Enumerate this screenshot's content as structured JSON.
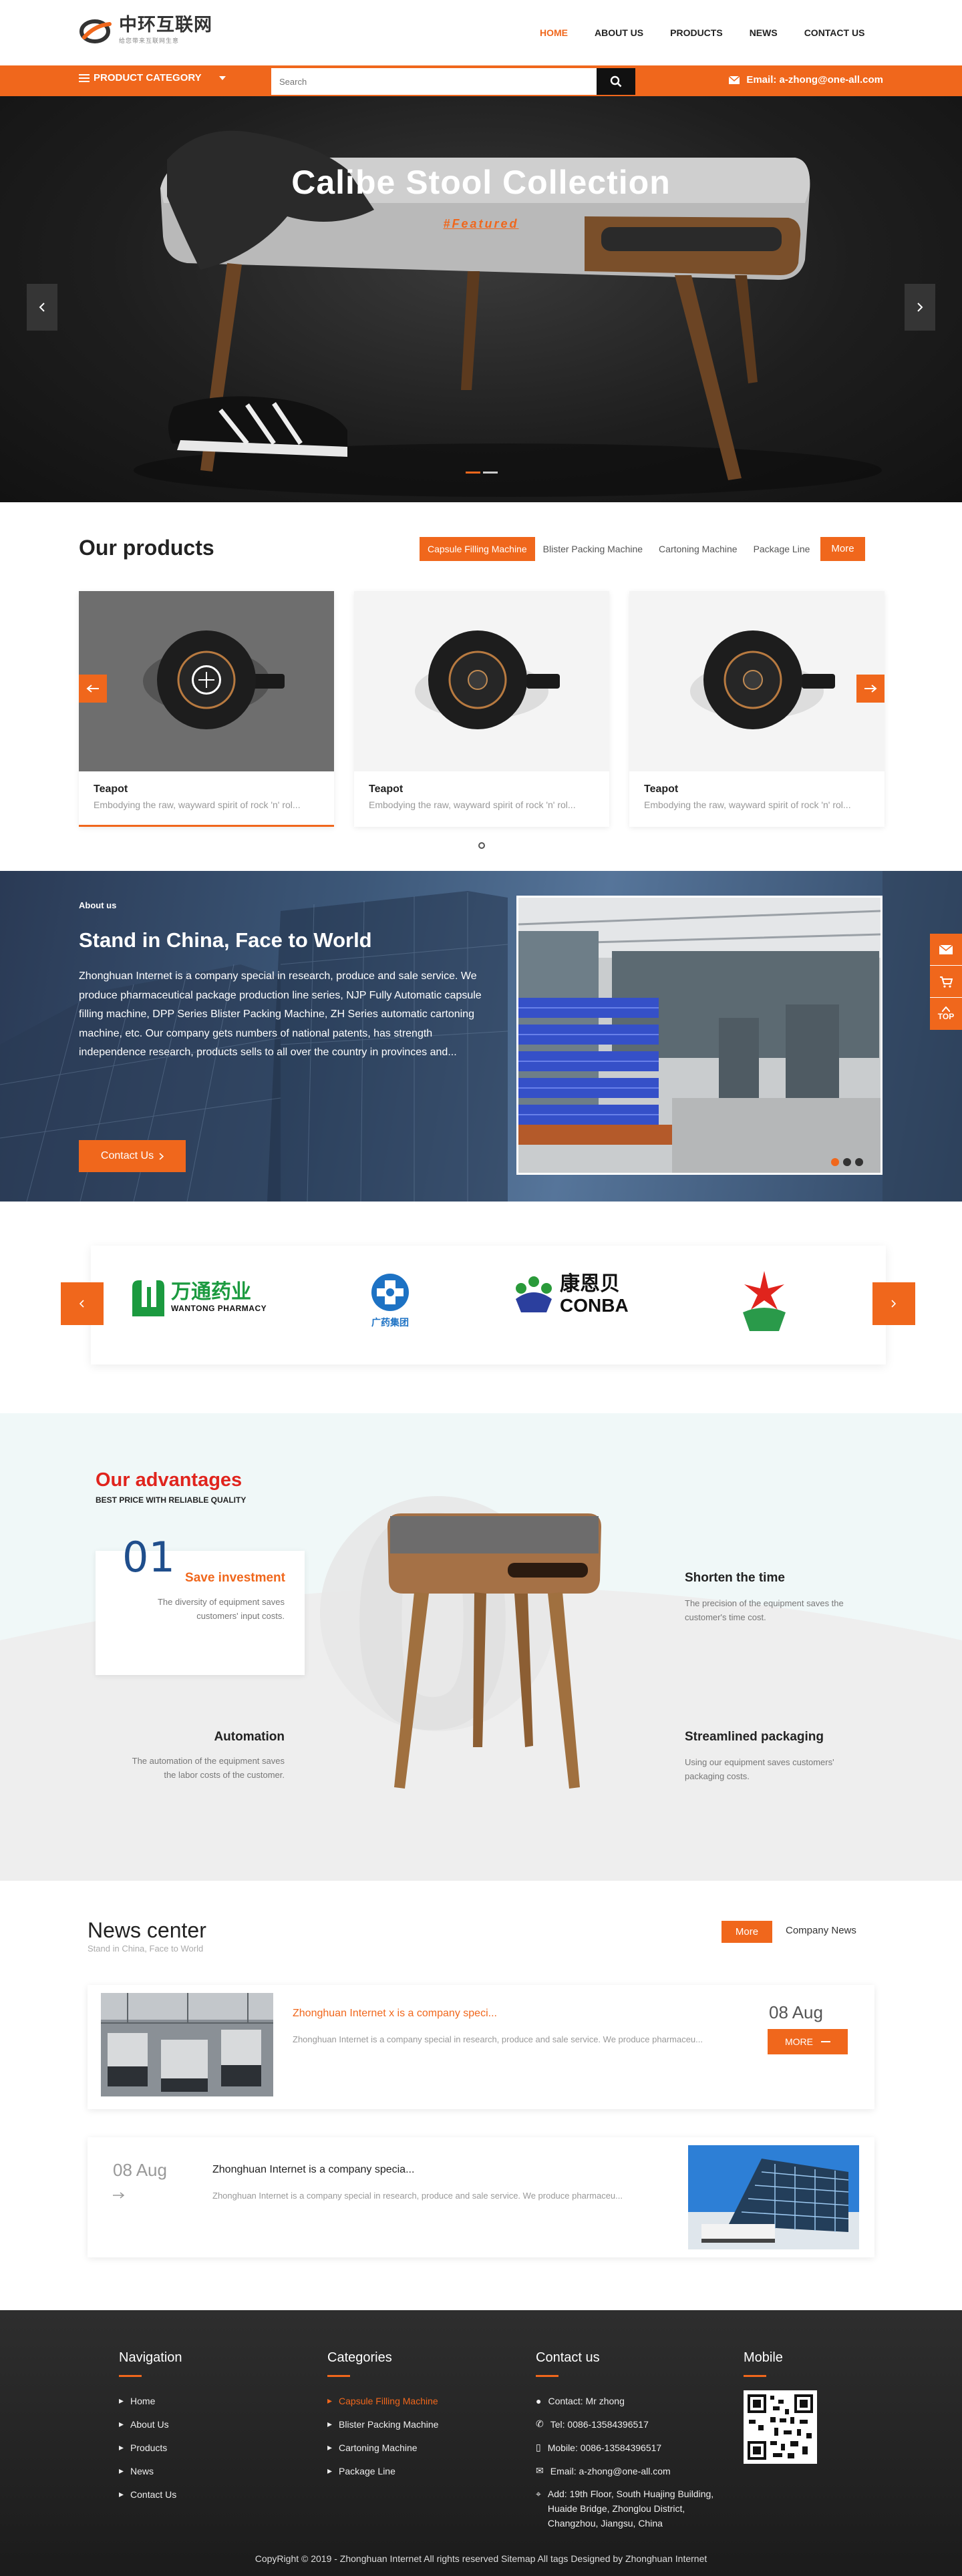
{
  "header": {
    "logo_text": "中环互联网",
    "logo_sub": "给您带来互联网生意",
    "nav": [
      {
        "label": "HOME",
        "active": true
      },
      {
        "label": "ABOUT US",
        "active": false
      },
      {
        "label": "PRODUCTS",
        "active": false
      },
      {
        "label": "NEWS",
        "active": false
      },
      {
        "label": "CONTACT US",
        "active": false
      }
    ]
  },
  "bar": {
    "category_label": "PRODUCT CATEGORY",
    "search_placeholder": "Search",
    "email": "Email: a-zhong@one-all.com"
  },
  "hero": {
    "title": "Calibe Stool Collection",
    "subtitle": "#Featured"
  },
  "products": {
    "title": "Our products",
    "tabs": [
      "Capsule Filling Machine",
      "Blister Packing Machine",
      "Cartoning Machine",
      "Package Line"
    ],
    "more_label": "More",
    "cards": [
      {
        "name": "Teapot",
        "desc": "Embodying the raw, wayward spirit of rock 'n' rol..."
      },
      {
        "name": "Teapot",
        "desc": "Embodying the raw, wayward spirit of rock 'n' rol..."
      },
      {
        "name": "Teapot",
        "desc": "Embodying the raw, wayward spirit of rock 'n' rol..."
      }
    ]
  },
  "about": {
    "label": "About us",
    "title": "Stand in China, Face to World",
    "body": "Zhonghuan Internet is a company special in research, produce and sale service. We produce pharmaceutical package production line series, NJP Fully Automatic capsule filling machine, DPP Series Blister Packing Machine, ZH Series automatic cartoning machine, etc. Our company gets numbers of national patents, has strength independence research, products sells to all over the country in provinces and...",
    "button": "Contact Us"
  },
  "partners": [
    {
      "cn": "万通药业",
      "en": "WANTONG PHARMACY"
    },
    {
      "cn": "广药集团",
      "en": ""
    },
    {
      "cn": "康恩贝",
      "en": "CONBA"
    },
    {
      "cn": "",
      "en": ""
    }
  ],
  "advantages": {
    "title": "Our advantages",
    "subtitle": "BEST PRICE WITH RELIABLE QUALITY",
    "number": "01",
    "items": [
      {
        "title": "Save investment",
        "text": "The diversity of equipment saves customers' input costs."
      },
      {
        "title": "Shorten the time",
        "text": "The precision of the equipment saves the customer's time cost."
      },
      {
        "title": "Automation",
        "text": "The automation of the equipment saves the labor costs of the customer."
      },
      {
        "title": "Streamlined packaging",
        "text": "Using our equipment saves customers' packaging costs."
      }
    ]
  },
  "news": {
    "title": "News center",
    "subtitle": "Stand in China, Face to World",
    "more_label": "More",
    "company_label": "Company News",
    "items": [
      {
        "title": "Zhonghuan Internet x is a company speci...",
        "text": "Zhonghuan Internet is a company special in research, produce and sale service. We produce pharmaceu...",
        "date": "08 Aug",
        "button": "MORE"
      },
      {
        "title": "Zhonghuan Internet is a company specia...",
        "text": "Zhonghuan Internet is a company special in research, produce and sale service. We produce pharmaceu...",
        "date": "08 Aug"
      }
    ]
  },
  "footer": {
    "navigation": {
      "title": "Navigation",
      "links": [
        "Home",
        "About Us",
        "Products",
        "News",
        "Contact Us"
      ]
    },
    "categories": {
      "title": "Categories",
      "links": [
        "Capsule Filling Machine",
        "Blister Packing Machine",
        "Cartoning Machine",
        "Package Line"
      ]
    },
    "contact": {
      "title": "Contact us",
      "items": [
        "Contact: Mr zhong",
        "Tel: 0086-13584396517",
        "Mobile: 0086-13584396517",
        "Email: a-zhong@one-all.com",
        "Add: 19th Floor, South Huajing Building, Huaide Bridge, Zhonglou District, Changzhou, Jiangsu, China"
      ]
    },
    "mobile": {
      "title": "Mobile"
    },
    "copyright": "CopyRight © 2019 - Zhonghuan Internet All rights reserved Sitemap All tags Designed by Zhonghuan Internet"
  },
  "side_tools": {
    "top_label": "TOP"
  },
  "colors": {
    "accent": "#f0671c",
    "dark": "#111111",
    "red_title": "#e0241d",
    "number_blue": "#1f4e8c"
  }
}
